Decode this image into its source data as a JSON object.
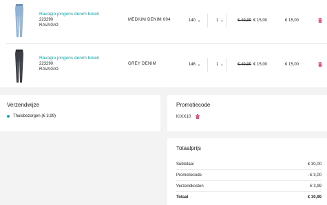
{
  "colors": {
    "accent": "#1aa5a8",
    "delete": "#e2557a"
  },
  "cart": {
    "items": [
      {
        "name": "Ravagio jongens denim broek",
        "sku": "223290",
        "brand": "RAVAGIO",
        "color": "MEDIUM DENIM 004",
        "size": "140",
        "quantity": "1",
        "old_price": "€ 49,99",
        "price": "€ 15,00",
        "total": "€ 15,00",
        "image": "light-blue-jeans"
      },
      {
        "name": "Ravagio jongens denim broek",
        "sku": "223290",
        "brand": "RAVAGIO",
        "color": "GREY DENIM",
        "size": "146",
        "quantity": "1",
        "old_price": "€ 49,99",
        "price": "€ 15,00",
        "total": "€ 15,00",
        "image": "grey-jeans"
      }
    ]
  },
  "shipping": {
    "title": "Verzendwijze",
    "option": "Thuisbezorgen (€ 3,99)"
  },
  "promo": {
    "title": "Promotiecode",
    "code": "KIXX10"
  },
  "summary": {
    "title": "Totaalprijs",
    "rows": [
      {
        "label": "Subtotaal",
        "value": "€ 30,00"
      },
      {
        "label": "Promotiecode",
        "value": "- € 3,00"
      },
      {
        "label": "Verzendkosten",
        "value": "€ 3,99"
      },
      {
        "label": "Totaal",
        "value": "€ 30,99"
      }
    ]
  }
}
